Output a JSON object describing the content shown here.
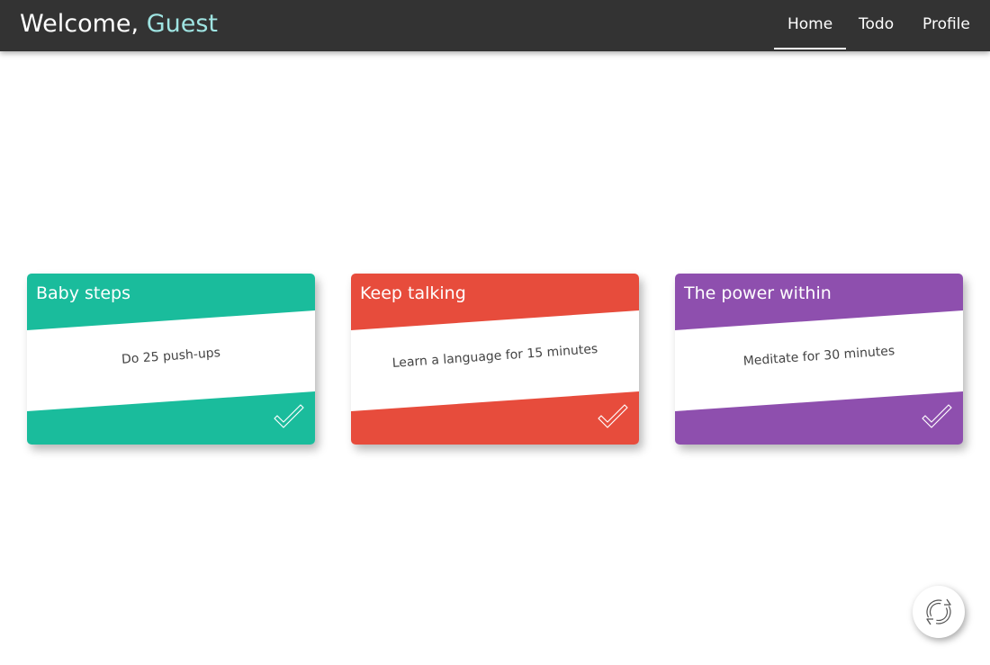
{
  "header": {
    "welcome_prefix": "Welcome,",
    "user_name": "Guest",
    "nav": [
      "Home",
      "Todo",
      "Profile"
    ],
    "active_nav": "Home"
  },
  "cards": [
    {
      "title": "Baby steps",
      "task": "Do 25 push-ups",
      "color": "#1abc9c",
      "icon": "checkmark-icon"
    },
    {
      "title": "Keep talking",
      "task": "Learn a language for 15 minutes",
      "color": "#e74c3c",
      "icon": "checkmark-icon"
    },
    {
      "title": "The power within",
      "task": "Meditate for 30 minutes",
      "color": "#8e4fae",
      "icon": "checkmark-icon"
    }
  ],
  "refresh_button": {
    "icon": "refresh-icon"
  },
  "colors": {
    "navbar": "#333333",
    "accent_name": "#9fe4e2"
  }
}
